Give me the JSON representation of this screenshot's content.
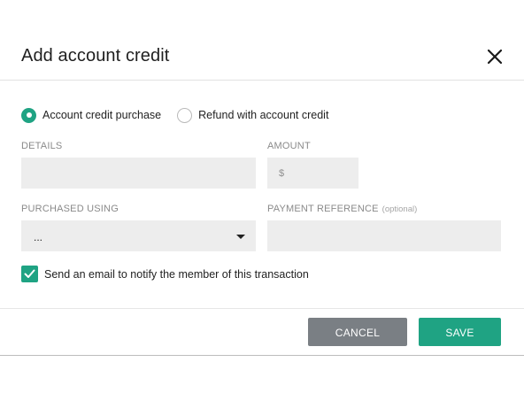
{
  "dialog": {
    "title": "Add account credit",
    "close_icon": "close-icon"
  },
  "credit_type": {
    "options": [
      {
        "label": "Account credit purchase",
        "selected": true
      },
      {
        "label": "Refund with account credit",
        "selected": false
      }
    ]
  },
  "fields": {
    "details": {
      "label": "DETAILS",
      "value": "",
      "placeholder": ""
    },
    "amount": {
      "label": "AMOUNT",
      "prefix": "$",
      "value": ""
    },
    "purchased_using": {
      "label": "PURCHASED USING",
      "selected_value": "..."
    },
    "payment_reference": {
      "label": "PAYMENT REFERENCE",
      "optional_note": "(optional)",
      "value": ""
    }
  },
  "notify": {
    "label": "Send an email to notify the member of this transaction",
    "checked": true
  },
  "buttons": {
    "cancel": "CANCEL",
    "save": "SAVE"
  },
  "colors": {
    "accent": "#1fa383",
    "cancel_button": "#7a7f84",
    "input_background": "#ededed"
  }
}
